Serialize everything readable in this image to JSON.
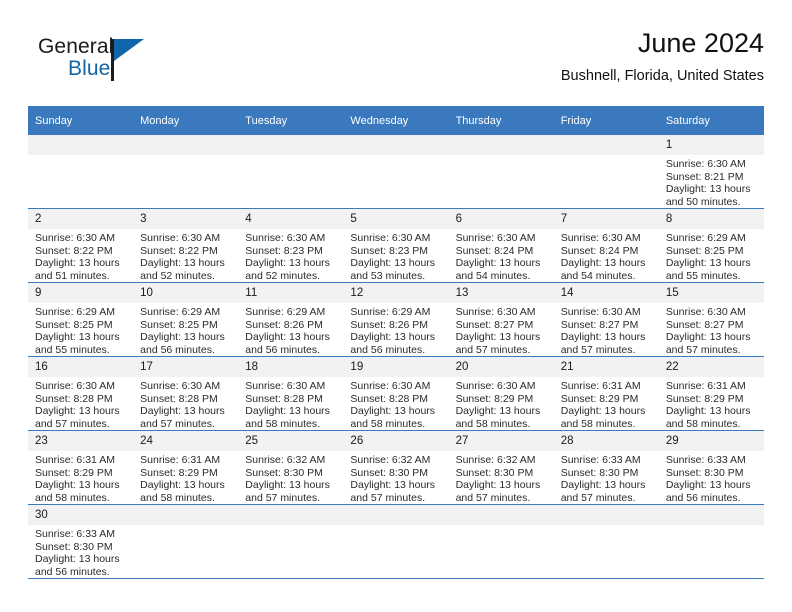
{
  "brand": {
    "word_one": "General",
    "word_two": "Blue",
    "flag_icon": "triangle-flag-icon"
  },
  "header": {
    "title": "June 2024",
    "location": "Bushnell, Florida, United States"
  },
  "calendar": {
    "accent_color": "#3a79bd",
    "daynum_band_color": "#f2f2f2",
    "weekday_headers": [
      "Sunday",
      "Monday",
      "Tuesday",
      "Wednesday",
      "Thursday",
      "Friday",
      "Saturday"
    ],
    "weeks": [
      [
        {
          "day": "",
          "lines": []
        },
        {
          "day": "",
          "lines": []
        },
        {
          "day": "",
          "lines": []
        },
        {
          "day": "",
          "lines": []
        },
        {
          "day": "",
          "lines": []
        },
        {
          "day": "",
          "lines": []
        },
        {
          "day": "1",
          "lines": [
            "Sunrise: 6:30 AM",
            "Sunset: 8:21 PM",
            "Daylight: 13 hours",
            "and 50 minutes."
          ]
        }
      ],
      [
        {
          "day": "2",
          "lines": [
            "Sunrise: 6:30 AM",
            "Sunset: 8:22 PM",
            "Daylight: 13 hours",
            "and 51 minutes."
          ]
        },
        {
          "day": "3",
          "lines": [
            "Sunrise: 6:30 AM",
            "Sunset: 8:22 PM",
            "Daylight: 13 hours",
            "and 52 minutes."
          ]
        },
        {
          "day": "4",
          "lines": [
            "Sunrise: 6:30 AM",
            "Sunset: 8:23 PM",
            "Daylight: 13 hours",
            "and 52 minutes."
          ]
        },
        {
          "day": "5",
          "lines": [
            "Sunrise: 6:30 AM",
            "Sunset: 8:23 PM",
            "Daylight: 13 hours",
            "and 53 minutes."
          ]
        },
        {
          "day": "6",
          "lines": [
            "Sunrise: 6:30 AM",
            "Sunset: 8:24 PM",
            "Daylight: 13 hours",
            "and 54 minutes."
          ]
        },
        {
          "day": "7",
          "lines": [
            "Sunrise: 6:30 AM",
            "Sunset: 8:24 PM",
            "Daylight: 13 hours",
            "and 54 minutes."
          ]
        },
        {
          "day": "8",
          "lines": [
            "Sunrise: 6:29 AM",
            "Sunset: 8:25 PM",
            "Daylight: 13 hours",
            "and 55 minutes."
          ]
        }
      ],
      [
        {
          "day": "9",
          "lines": [
            "Sunrise: 6:29 AM",
            "Sunset: 8:25 PM",
            "Daylight: 13 hours",
            "and 55 minutes."
          ]
        },
        {
          "day": "10",
          "lines": [
            "Sunrise: 6:29 AM",
            "Sunset: 8:25 PM",
            "Daylight: 13 hours",
            "and 56 minutes."
          ]
        },
        {
          "day": "11",
          "lines": [
            "Sunrise: 6:29 AM",
            "Sunset: 8:26 PM",
            "Daylight: 13 hours",
            "and 56 minutes."
          ]
        },
        {
          "day": "12",
          "lines": [
            "Sunrise: 6:29 AM",
            "Sunset: 8:26 PM",
            "Daylight: 13 hours",
            "and 56 minutes."
          ]
        },
        {
          "day": "13",
          "lines": [
            "Sunrise: 6:30 AM",
            "Sunset: 8:27 PM",
            "Daylight: 13 hours",
            "and 57 minutes."
          ]
        },
        {
          "day": "14",
          "lines": [
            "Sunrise: 6:30 AM",
            "Sunset: 8:27 PM",
            "Daylight: 13 hours",
            "and 57 minutes."
          ]
        },
        {
          "day": "15",
          "lines": [
            "Sunrise: 6:30 AM",
            "Sunset: 8:27 PM",
            "Daylight: 13 hours",
            "and 57 minutes."
          ]
        }
      ],
      [
        {
          "day": "16",
          "lines": [
            "Sunrise: 6:30 AM",
            "Sunset: 8:28 PM",
            "Daylight: 13 hours",
            "and 57 minutes."
          ]
        },
        {
          "day": "17",
          "lines": [
            "Sunrise: 6:30 AM",
            "Sunset: 8:28 PM",
            "Daylight: 13 hours",
            "and 57 minutes."
          ]
        },
        {
          "day": "18",
          "lines": [
            "Sunrise: 6:30 AM",
            "Sunset: 8:28 PM",
            "Daylight: 13 hours",
            "and 58 minutes."
          ]
        },
        {
          "day": "19",
          "lines": [
            "Sunrise: 6:30 AM",
            "Sunset: 8:28 PM",
            "Daylight: 13 hours",
            "and 58 minutes."
          ]
        },
        {
          "day": "20",
          "lines": [
            "Sunrise: 6:30 AM",
            "Sunset: 8:29 PM",
            "Daylight: 13 hours",
            "and 58 minutes."
          ]
        },
        {
          "day": "21",
          "lines": [
            "Sunrise: 6:31 AM",
            "Sunset: 8:29 PM",
            "Daylight: 13 hours",
            "and 58 minutes."
          ]
        },
        {
          "day": "22",
          "lines": [
            "Sunrise: 6:31 AM",
            "Sunset: 8:29 PM",
            "Daylight: 13 hours",
            "and 58 minutes."
          ]
        }
      ],
      [
        {
          "day": "23",
          "lines": [
            "Sunrise: 6:31 AM",
            "Sunset: 8:29 PM",
            "Daylight: 13 hours",
            "and 58 minutes."
          ]
        },
        {
          "day": "24",
          "lines": [
            "Sunrise: 6:31 AM",
            "Sunset: 8:29 PM",
            "Daylight: 13 hours",
            "and 58 minutes."
          ]
        },
        {
          "day": "25",
          "lines": [
            "Sunrise: 6:32 AM",
            "Sunset: 8:30 PM",
            "Daylight: 13 hours",
            "and 57 minutes."
          ]
        },
        {
          "day": "26",
          "lines": [
            "Sunrise: 6:32 AM",
            "Sunset: 8:30 PM",
            "Daylight: 13 hours",
            "and 57 minutes."
          ]
        },
        {
          "day": "27",
          "lines": [
            "Sunrise: 6:32 AM",
            "Sunset: 8:30 PM",
            "Daylight: 13 hours",
            "and 57 minutes."
          ]
        },
        {
          "day": "28",
          "lines": [
            "Sunrise: 6:33 AM",
            "Sunset: 8:30 PM",
            "Daylight: 13 hours",
            "and 57 minutes."
          ]
        },
        {
          "day": "29",
          "lines": [
            "Sunrise: 6:33 AM",
            "Sunset: 8:30 PM",
            "Daylight: 13 hours",
            "and 56 minutes."
          ]
        }
      ],
      [
        {
          "day": "30",
          "lines": [
            "Sunrise: 6:33 AM",
            "Sunset: 8:30 PM",
            "Daylight: 13 hours",
            "and 56 minutes."
          ]
        },
        {
          "day": "",
          "lines": []
        },
        {
          "day": "",
          "lines": []
        },
        {
          "day": "",
          "lines": []
        },
        {
          "day": "",
          "lines": []
        },
        {
          "day": "",
          "lines": []
        },
        {
          "day": "",
          "lines": []
        }
      ]
    ]
  }
}
